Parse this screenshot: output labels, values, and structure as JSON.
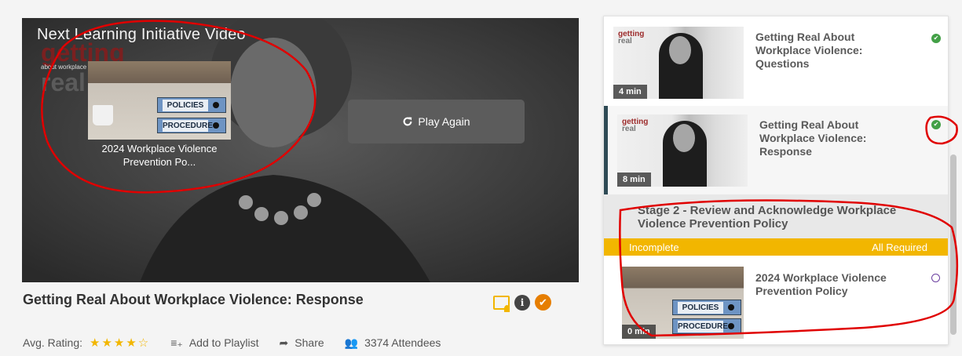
{
  "player": {
    "next_heading": "Next Learning Initiative Video",
    "logo_text": "getting",
    "logo_sub": "about workplace",
    "logo_text2": "real",
    "next_thumb_binder_1": "POLICIES",
    "next_thumb_binder_2": "PROCEDURE",
    "next_caption": "2024 Workplace Violence Prevention Po...",
    "play_again_label": "Play Again"
  },
  "video": {
    "title": "Getting Real About Workplace Violence: Response"
  },
  "meta": {
    "rating_label": "Avg. Rating:",
    "rating_value": 4.5,
    "stars": "★★★★☆",
    "add_to_playlist": "Add to Playlist",
    "share": "Share",
    "attendees": "3374 Attendees"
  },
  "playlist": {
    "items": [
      {
        "title": "Getting Real About Workplace Violence: Questions",
        "duration": "4 min",
        "status": "complete"
      },
      {
        "title": "Getting Real About Workplace Violence: Response",
        "duration": "8 min",
        "status": "complete"
      }
    ],
    "stage": {
      "title": "Stage 2 - Review and Acknowledge Workplace Violence Prevention Policy",
      "status": "Incomplete",
      "requirement": "All Required"
    },
    "stage_items": [
      {
        "title": "2024 Workplace Violence Prevention Policy",
        "duration": "0 min",
        "status": "incomplete"
      }
    ]
  },
  "colors": {
    "accent_yellow": "#f2b600",
    "complete_green": "#43a047",
    "active_border": "#2e4a55",
    "annotation_red": "#e00000"
  }
}
